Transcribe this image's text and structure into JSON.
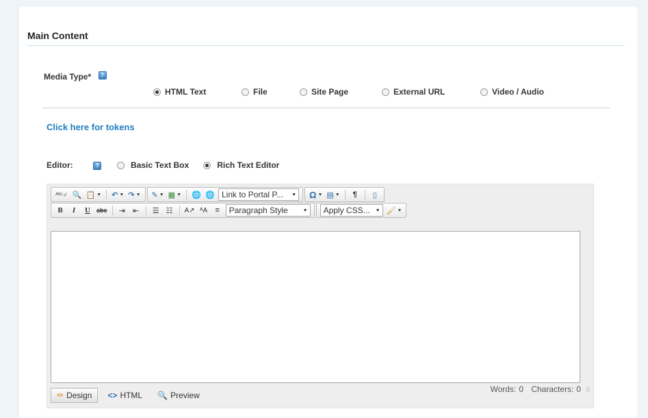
{
  "section": {
    "title": "Main Content"
  },
  "media_type": {
    "label": "Media Type*",
    "options": [
      {
        "label": "HTML Text",
        "selected": true
      },
      {
        "label": "File",
        "selected": false
      },
      {
        "label": "Site Page",
        "selected": false
      },
      {
        "label": "External URL",
        "selected": false
      },
      {
        "label": "Video / Audio",
        "selected": false
      }
    ]
  },
  "tokens_link": "Click here for tokens",
  "editor_choice": {
    "label": "Editor:",
    "options": [
      {
        "label": "Basic Text Box",
        "selected": false
      },
      {
        "label": "Rich Text Editor",
        "selected": true
      }
    ]
  },
  "toolbar": {
    "link_to_portal": "Link to Portal P...",
    "paragraph_style": "Paragraph Style",
    "apply_css": "Apply CSS..."
  },
  "modes": {
    "design": "Design",
    "html": "HTML",
    "preview": "Preview"
  },
  "stats": {
    "words_label": "Words:",
    "words": "0",
    "chars_label": "Characters:",
    "chars": "0"
  },
  "colors": {
    "link": "#1f7fc0",
    "background": "#eef4f8"
  }
}
